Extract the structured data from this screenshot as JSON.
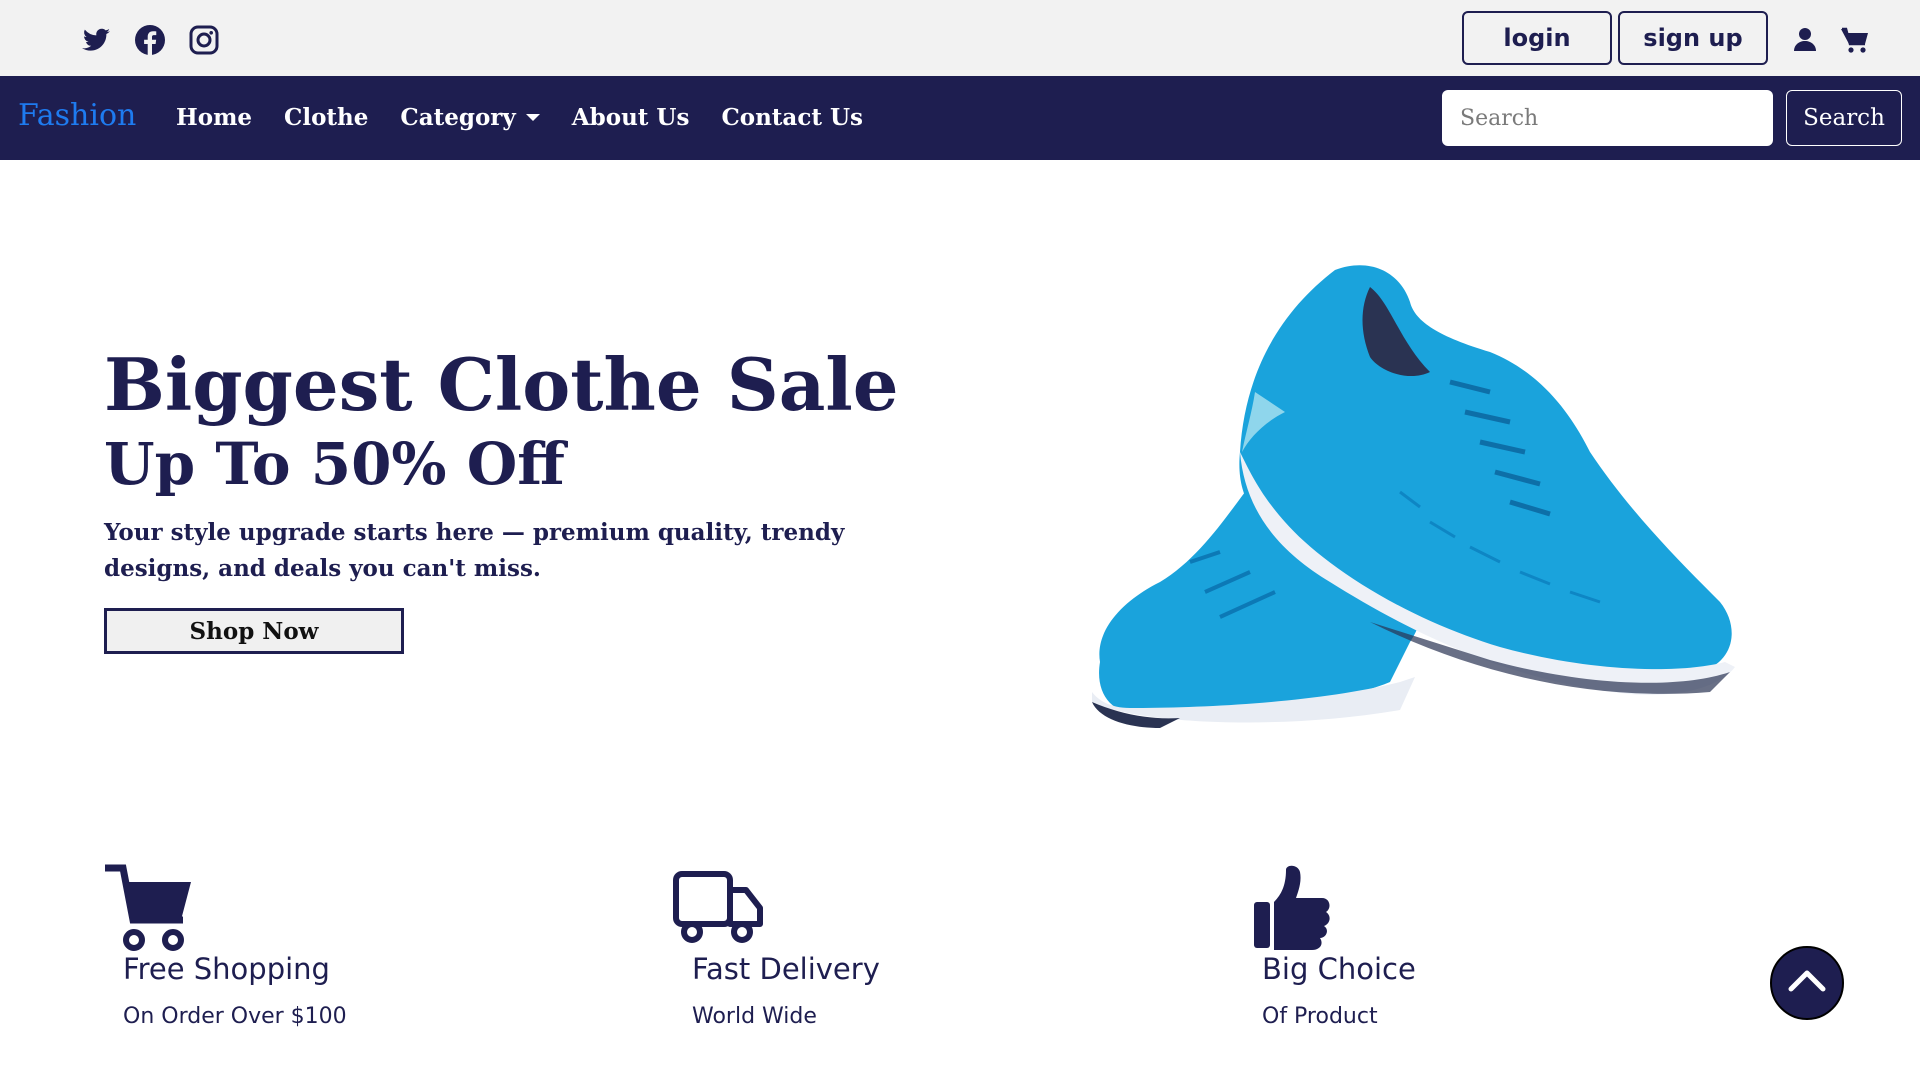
{
  "topbar": {
    "social_icons": [
      "twitter-icon",
      "facebook-icon",
      "instagram-icon"
    ],
    "login_label": "login",
    "signup_label": "sign up",
    "right_icons": [
      "user-icon",
      "cart-icon"
    ]
  },
  "navbar": {
    "brand": "Fashion",
    "links": [
      "Home",
      "Clothe",
      "Category",
      "About Us",
      "Contact Us"
    ],
    "search_placeholder": "Search",
    "search_button": "Search"
  },
  "hero": {
    "title": "Biggest Clothe Sale",
    "subtitle": "Up To 50% Off",
    "text": "Your style upgrade starts here — premium quality, trendy designs, and deals you can't miss.",
    "cta": "Shop Now",
    "image": "blue-sneakers-image"
  },
  "features": [
    {
      "icon": "cart-icon",
      "title": "Free Shopping",
      "subtitle": "On Order Over $100"
    },
    {
      "icon": "truck-icon",
      "title": "Fast Delivery",
      "subtitle": "World Wide"
    },
    {
      "icon": "thumbs-up-icon",
      "title": "Big Choice",
      "subtitle": "Of Product"
    }
  ],
  "scroll_top_icon": "chevron-up-icon",
  "colors": {
    "navy": "#1e1e50",
    "brand_blue": "#1e7bf0",
    "topbar_bg": "#f2f2f2",
    "shoe_blue": "#1aa3dc"
  }
}
